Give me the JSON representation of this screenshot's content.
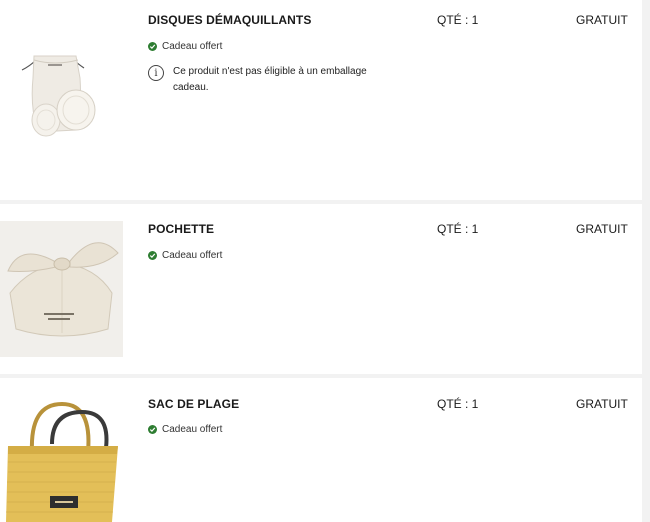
{
  "items": [
    {
      "name": "DISQUES DÉMAQUILLANTS",
      "qty": "QTÉ : 1",
      "price": "GRATUIT",
      "gift_label": "Cadeau offert",
      "notice": "Ce produit n'est pas éligible à un emballage cadeau.",
      "image_icon": "cotton-pads-pouch-image"
    },
    {
      "name": "POCHETTE",
      "qty": "QTÉ : 1",
      "price": "GRATUIT",
      "gift_label": "Cadeau offert",
      "image_icon": "knot-pouch-image"
    },
    {
      "name": "SAC DE PLAGE",
      "qty": "QTÉ : 1",
      "price": "GRATUIT",
      "gift_label": "Cadeau offert",
      "image_icon": "straw-beach-bag-image"
    }
  ],
  "colors": {
    "check": "#2e7d32",
    "background": "#f2f2f2",
    "card": "#ffffff",
    "bag": "#e3bf58"
  }
}
